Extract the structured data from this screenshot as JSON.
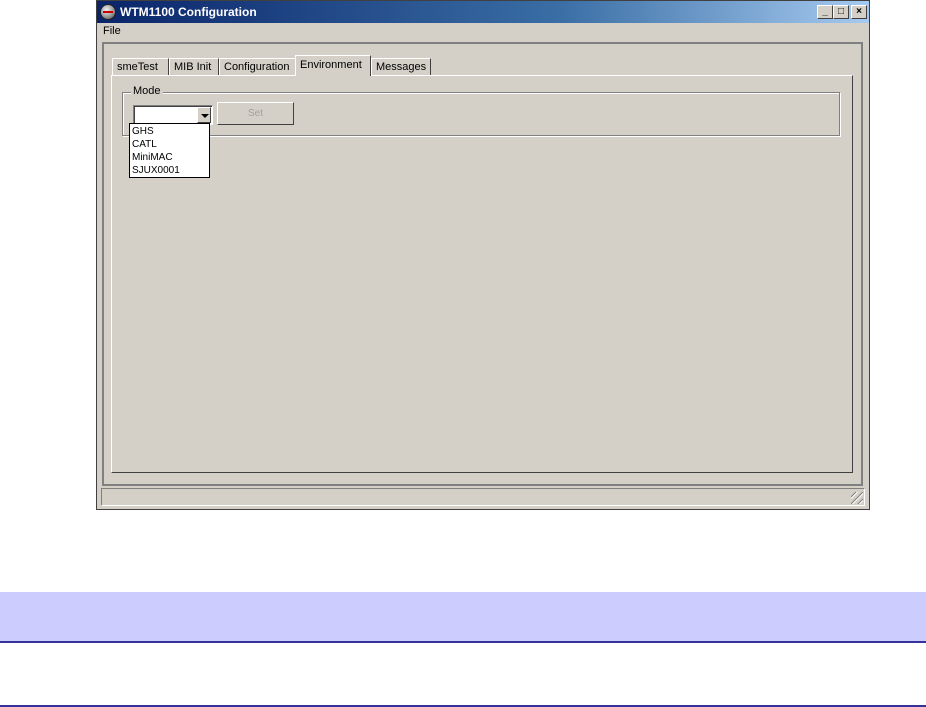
{
  "window": {
    "title": "WTM1100 Configuration",
    "controls": {
      "minimize": "_",
      "maximize": "□",
      "close": "×"
    }
  },
  "menu": {
    "file": "File"
  },
  "tabs": [
    {
      "label": "smeTest"
    },
    {
      "label": "MIB Init"
    },
    {
      "label": "Configuration"
    },
    {
      "label": "Environment",
      "active": true
    },
    {
      "label": "Messages"
    }
  ],
  "environment": {
    "group_label": "Mode",
    "combo_value": "",
    "set_button": "Set",
    "options": [
      "GHS",
      "CATL",
      "MiniMAC",
      "SJUX0001"
    ]
  },
  "colors": {
    "titlebar_start": "#0a246a",
    "face": "#d4d0c8",
    "band": "#ccccff",
    "rule": "#333399"
  }
}
